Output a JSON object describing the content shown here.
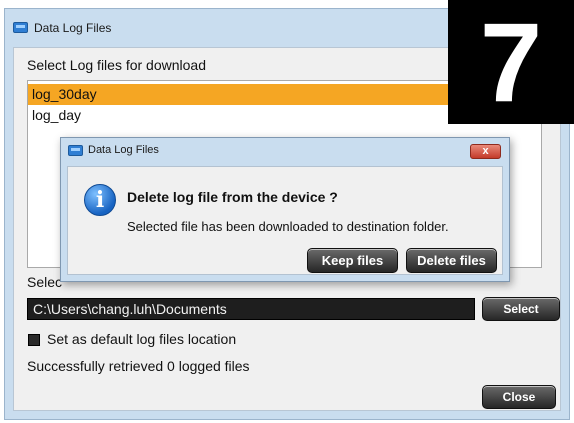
{
  "window": {
    "title": "Data Log Files",
    "select_prompt": "Select Log files for download",
    "files": [
      "log_30day",
      "log_day"
    ],
    "selected_file": "log_30day",
    "destination_label": "Selec",
    "destination_path": "C:\\Users\\chang.luh\\Documents",
    "select_button": "Select",
    "default_checkbox_label": "Set as default log files location",
    "status": "Successfully retrieved 0 logged files",
    "close_button": "Close"
  },
  "dialog": {
    "title": "Data Log Files",
    "close_glyph": "x",
    "heading": "Delete log file from the device ?",
    "message": "Selected file has been downloaded to destination folder.",
    "keep_button": "Keep files",
    "delete_button": "Delete files"
  },
  "badge": {
    "number": "7"
  },
  "colors": {
    "selection": "#f5a623",
    "window_frame": "#c9ddef",
    "dark_button": "#2b2b2b",
    "path_field": "#1e1e1e"
  }
}
